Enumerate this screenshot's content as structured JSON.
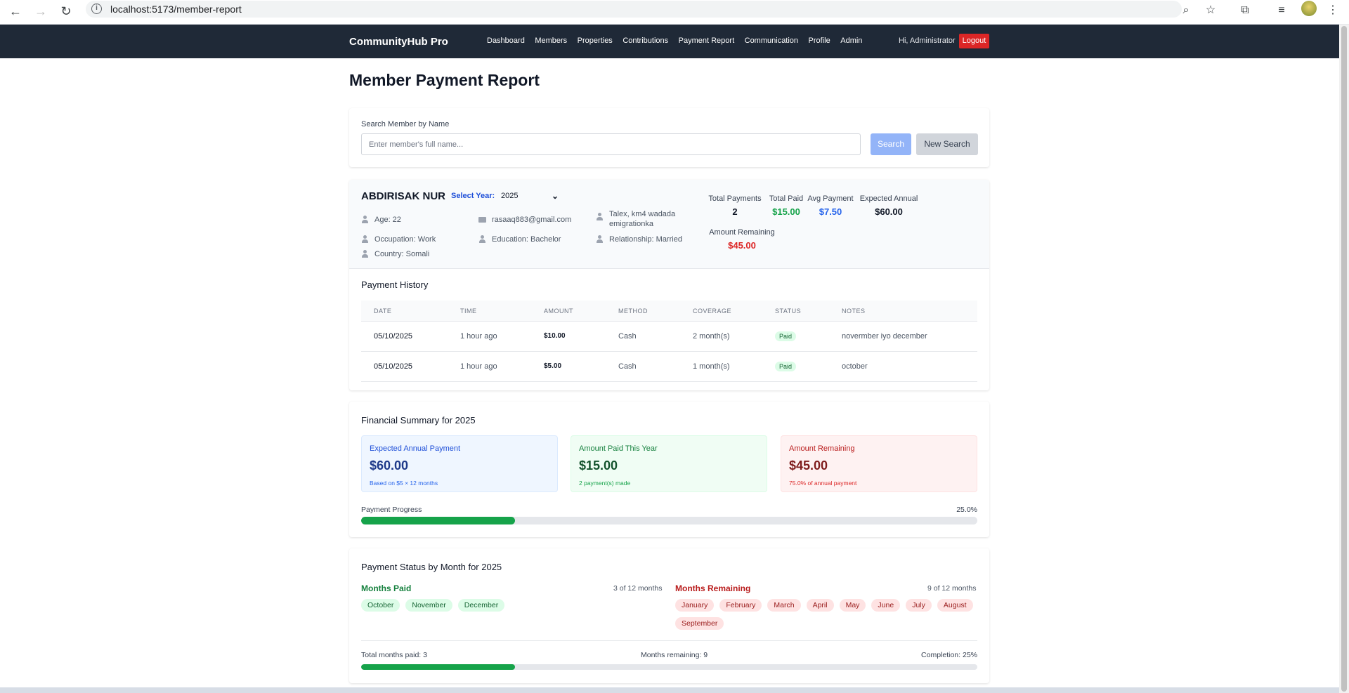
{
  "browser": {
    "url": "localhost:5173/member-report"
  },
  "nav": {
    "brand": "CommunityHub Pro",
    "links": [
      "Dashboard",
      "Members",
      "Properties",
      "Contributions",
      "Payment Report",
      "Communication",
      "Profile",
      "Admin"
    ],
    "greeting": "Hi, Administrator",
    "logout": "Logout"
  },
  "page": {
    "title": "Member Payment Report"
  },
  "search": {
    "label": "Search Member by Name",
    "placeholder": "Enter member's full name...",
    "search_btn": "Search",
    "new_btn": "New Search"
  },
  "member": {
    "name": "ABDIRISAK NUR",
    "year_label": "Select Year:",
    "year": "2025",
    "age": "Age: 22",
    "email": "rasaaq883@gmail.com",
    "address": "Talex, km4 wadada emigrationka",
    "occupation": "Occupation: Work",
    "education": "Education: Bachelor",
    "relationship": "Relationship: Married",
    "country": "Country: Somali"
  },
  "stats": {
    "total_payments_label": "Total Payments",
    "total_payments": "2",
    "total_paid_label": "Total Paid",
    "total_paid": "$15.00",
    "avg_payment_label": "Avg Payment",
    "avg_payment": "$7.50",
    "expected_annual_label": "Expected Annual",
    "expected_annual": "$60.00",
    "amount_remaining_label": "Amount Remaining",
    "amount_remaining": "$45.00"
  },
  "history": {
    "title": "Payment History",
    "columns": [
      "DATE",
      "TIME",
      "AMOUNT",
      "METHOD",
      "COVERAGE",
      "STATUS",
      "NOTES"
    ],
    "rows": [
      {
        "date": "05/10/2025",
        "time": "1 hour ago",
        "amount": "$10.00",
        "method": "Cash",
        "coverage": "2 month(s)",
        "status": "Paid",
        "notes": "novermber iyo december"
      },
      {
        "date": "05/10/2025",
        "time": "1 hour ago",
        "amount": "$5.00",
        "method": "Cash",
        "coverage": "1 month(s)",
        "status": "Paid",
        "notes": "october"
      }
    ]
  },
  "financial": {
    "title": "Financial Summary for 2025",
    "expected": {
      "label": "Expected Annual Payment",
      "value": "$60.00",
      "sub": "Based on $5 × 12 months"
    },
    "paid": {
      "label": "Amount Paid This Year",
      "value": "$15.00",
      "sub": "2 payment(s) made"
    },
    "remaining": {
      "label": "Amount Remaining",
      "value": "$45.00",
      "sub": "75.0% of annual payment"
    },
    "progress_label": "Payment Progress",
    "progress_text": "25.0%",
    "progress_value": 0.25
  },
  "months": {
    "title": "Payment Status by Month for 2025",
    "paid_title": "Months Paid",
    "paid_count": "3 of 12 months",
    "paid": [
      "October",
      "November",
      "December"
    ],
    "remaining_title": "Months Remaining",
    "remaining_count": "9 of 12 months",
    "remaining": [
      "January",
      "February",
      "March",
      "April",
      "May",
      "June",
      "July",
      "August",
      "September"
    ],
    "total_paid_text": "Total months paid: 3",
    "remaining_text": "Months remaining: 9",
    "completion_text": "Completion: 25%",
    "completion_value": 0.25
  },
  "colors": {
    "nav_bg": "#1f2937",
    "logout": "#dc2626",
    "green": "#16a34a",
    "blue": "#2563eb",
    "red": "#dc2626"
  }
}
